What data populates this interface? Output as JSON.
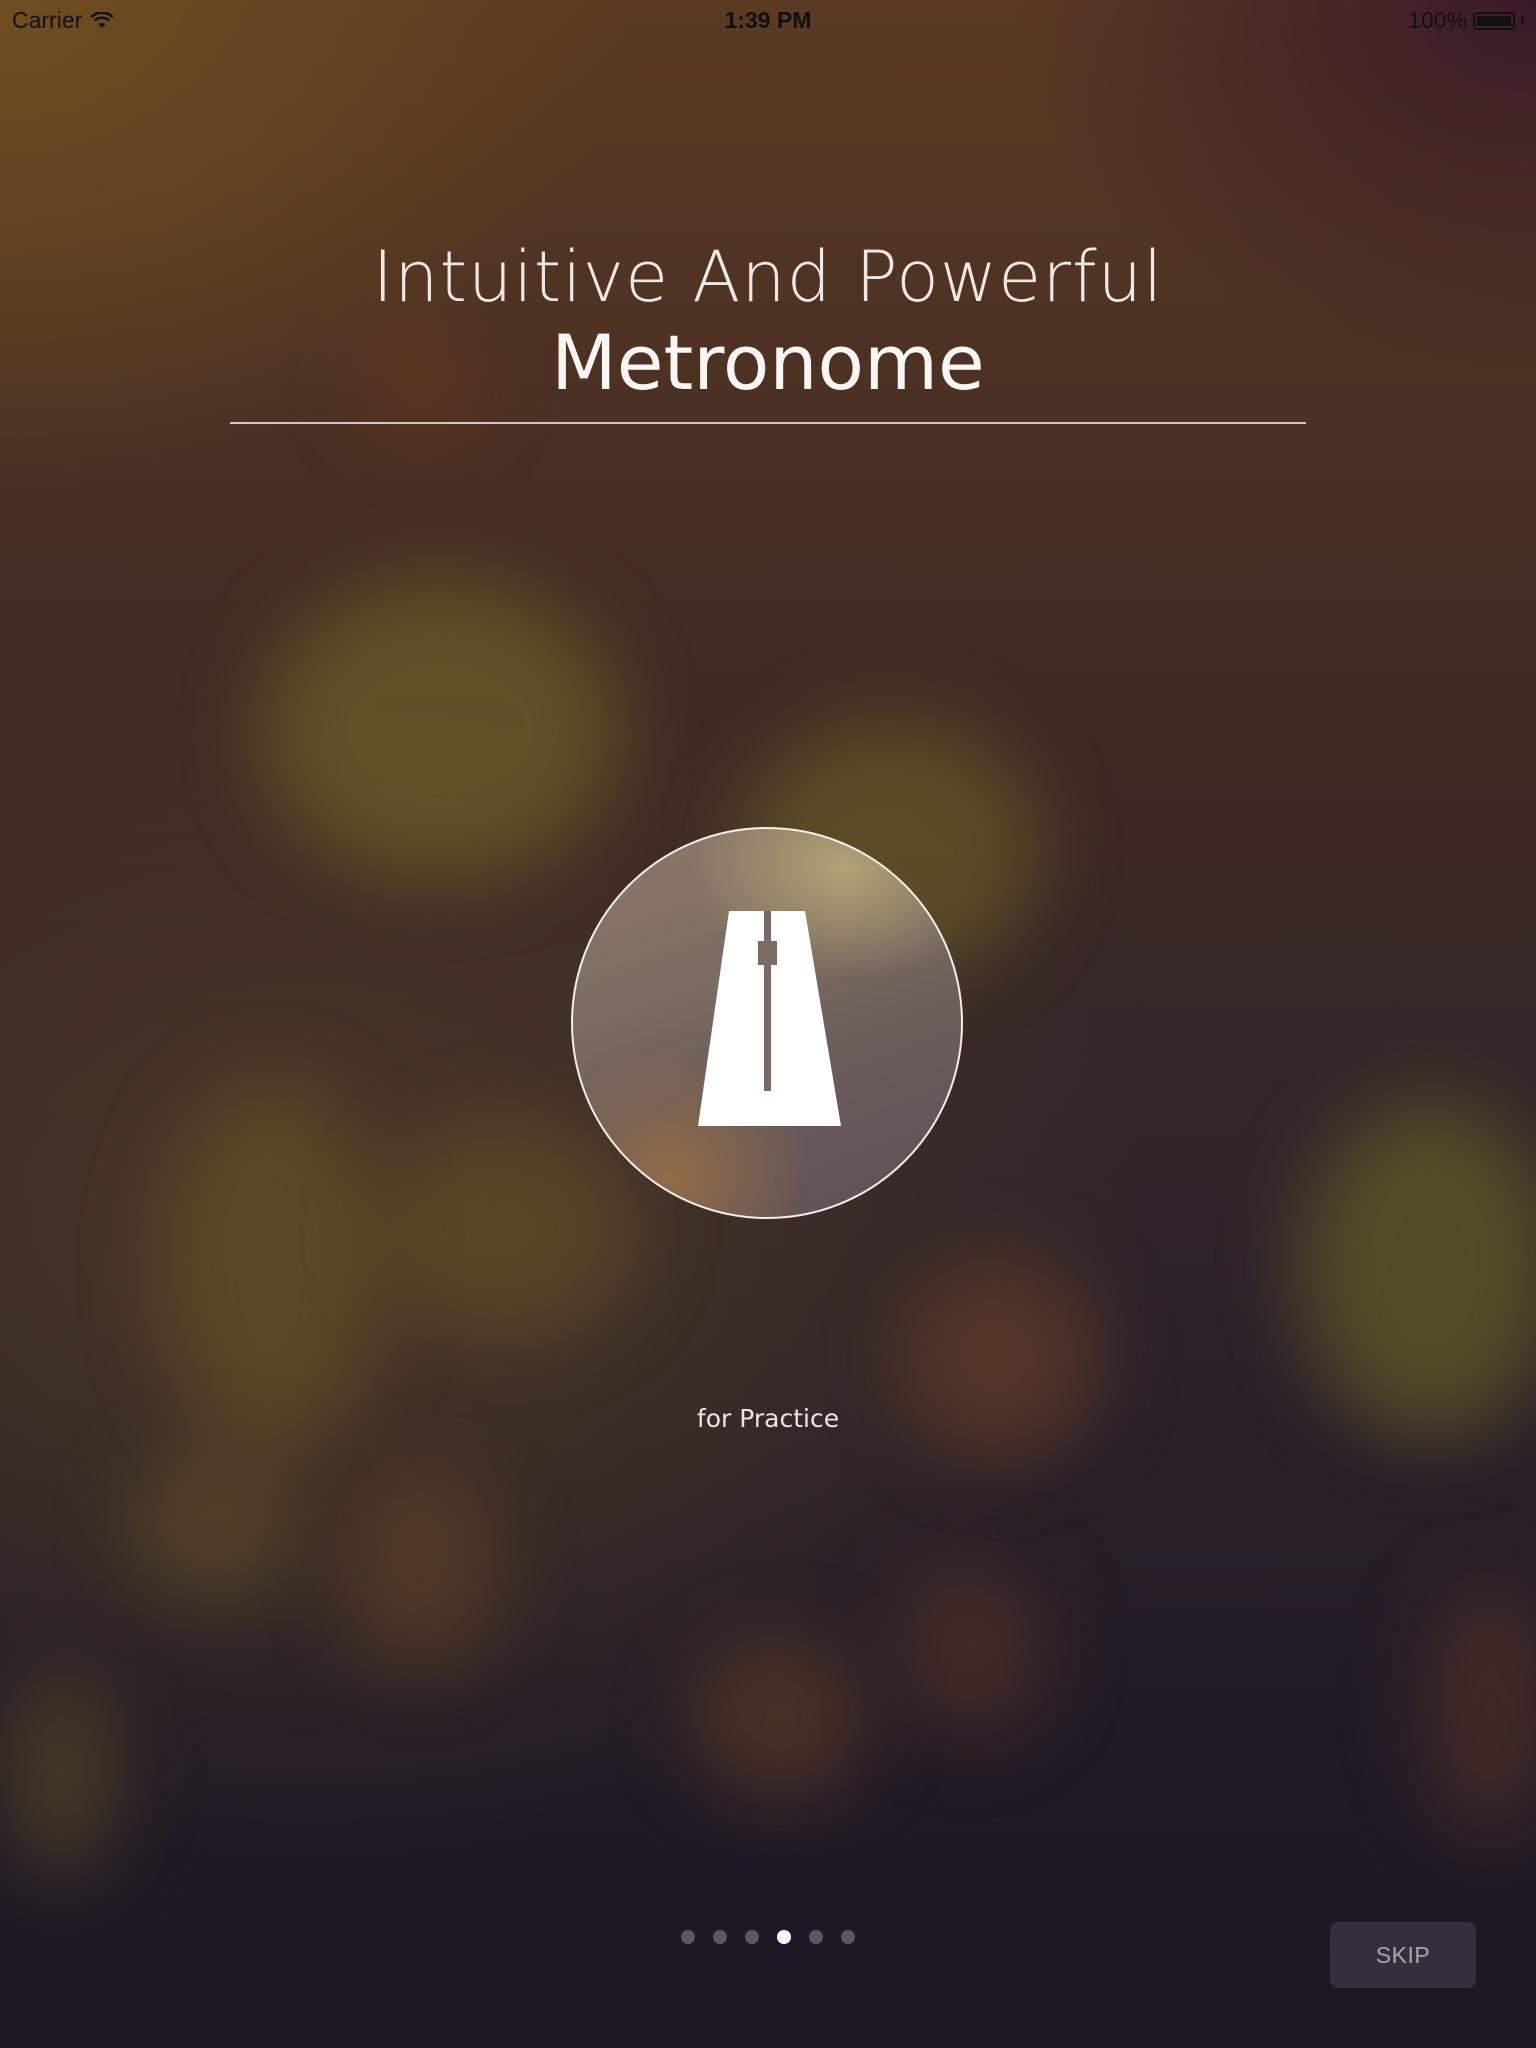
{
  "status_bar": {
    "carrier": "Carrier",
    "time": "1:39 PM",
    "battery": "100%"
  },
  "onboarding": {
    "subtitle": "Intuitive And Powerful",
    "title": "Metronome",
    "caption": "for Practice",
    "icon": "metronome-icon",
    "page_count": 6,
    "current_page": 4
  },
  "skip_label": "SKIP",
  "colors": {
    "accent_text": "#ffffff",
    "skip_bg": "#3c3744",
    "skip_text": "#a9a4ad"
  }
}
